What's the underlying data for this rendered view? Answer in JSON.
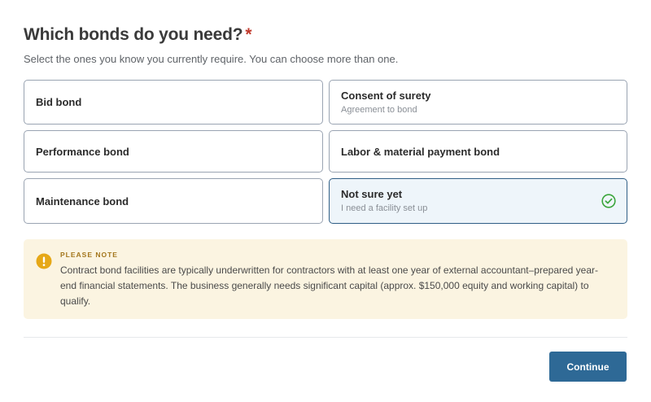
{
  "question": {
    "title": "Which bonds do you need?",
    "required_marker": "*",
    "subtitle": "Select the ones you know you currently require. You can choose more than one."
  },
  "options": [
    {
      "label": "Bid bond",
      "sublabel": "",
      "selected": false
    },
    {
      "label": "Consent of surety",
      "sublabel": "Agreement to bond",
      "selected": false
    },
    {
      "label": "Performance bond",
      "sublabel": "",
      "selected": false
    },
    {
      "label": "Labor & material payment bond",
      "sublabel": "",
      "selected": false
    },
    {
      "label": "Maintenance bond",
      "sublabel": "",
      "selected": false
    },
    {
      "label": "Not sure yet",
      "sublabel": "I need a facility set up",
      "selected": true
    }
  ],
  "note": {
    "heading": "PLEASE NOTE",
    "body": "Contract bond facilities are typically underwritten for contractors with at least one year of external accountant–prepared year-end financial statements. The business generally needs significant capital (approx. $150,000 equity and working capital) to qualify.",
    "icon": "exclamation-icon",
    "accent_color": "#e6a817",
    "background_color": "#fbf4e1"
  },
  "actions": {
    "continue_label": "Continue",
    "button_color": "#2e6996"
  },
  "selected_check_icon": "check-circle-icon",
  "selected_check_color": "#3aa53a"
}
